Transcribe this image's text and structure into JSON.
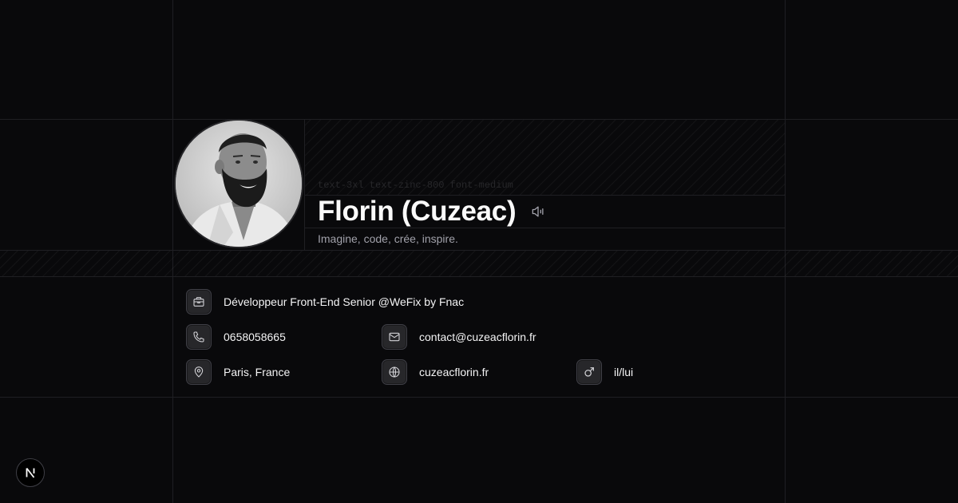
{
  "profile": {
    "class_hint": "text-3xl text-zinc-800 font-medium",
    "name": "Florin (Cuzeac)",
    "tagline": "Imagine, code, crée, inspire."
  },
  "info": {
    "job": "Développeur Front-End Senior @WeFix by Fnac",
    "phone": "0658058665",
    "email": "contact@cuzeacflorin.fr",
    "location": "Paris, France",
    "website": "cuzeacflorin.fr",
    "pronouns": "il/lui"
  },
  "icons": {
    "job": "briefcase-icon",
    "phone": "phone-icon",
    "email": "mail-icon",
    "location": "map-pin-icon",
    "website": "globe-icon",
    "pronouns": "male-symbol-icon",
    "pronounce": "volume-icon",
    "framework": "nextjs-logo"
  },
  "colors": {
    "background": "#09090b",
    "grid_line": "#1f1f23",
    "text_primary": "#fafafa",
    "text_muted": "#a1a1aa",
    "icon_box": "#27272a"
  },
  "badge": {
    "letter": "N"
  }
}
